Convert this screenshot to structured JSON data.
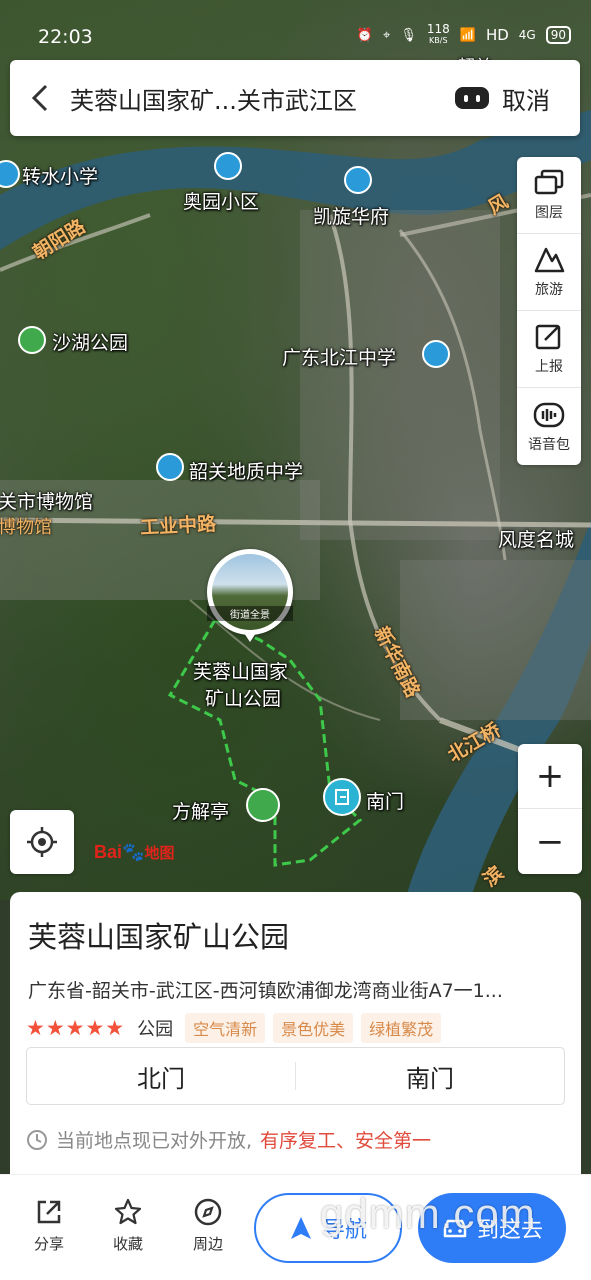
{
  "status_bar": {
    "time": "22:03",
    "speed_value": "118",
    "speed_unit": "KB/S",
    "hd": "HD",
    "network": "4G",
    "battery": "90"
  },
  "search": {
    "title": "芙蓉山国家矿...关市武江区",
    "cancel_label": "取消"
  },
  "tools": [
    {
      "label": "图层",
      "icon": "layers-icon"
    },
    {
      "label": "旅游",
      "icon": "travel-icon"
    },
    {
      "label": "上报",
      "icon": "report-edit-icon"
    },
    {
      "label": "语音包",
      "icon": "voice-pack-icon"
    }
  ],
  "map": {
    "pois": {
      "zhuanshui": "转水小学",
      "aoyuan": "奥园小区",
      "kaixuan": "凯旋华府",
      "shahu": "沙湖公园",
      "beijiang_school": "广东北江中学",
      "dizhi_school": "韶关地质中学",
      "museum": "关市博物馆",
      "museum2": "博物馆",
      "fengdu": "风度名城",
      "park_line1": "芙蓉山国家",
      "park_line2": "矿山公园",
      "fangjie": "方解亭",
      "nanmen": "南门",
      "top_right": "韶关"
    },
    "roads": {
      "chaoyang": "朝阳路",
      "gongyezhong": "工业中路",
      "xinhuanan": "新华南路",
      "beijiangqiao": "北江桥",
      "feng": "风",
      "bin": "滨"
    },
    "streetview_caption": "街道全景",
    "baidu_logo": "Bai地图"
  },
  "zoom": {
    "in": "+",
    "out": "−"
  },
  "place": {
    "name": "芙蓉山国家矿山公园",
    "address": "广东省-韶关市-武江区-西河镇欧浦御龙湾商业街A7一1...",
    "rating_stars": "★★★★★",
    "category": "公园",
    "tags": [
      "空气清新",
      "景色优美",
      "绿植繁茂"
    ],
    "gates": [
      "北门",
      "南门"
    ],
    "notice_text": "当前地点现已对外开放,",
    "notice_highlight": "有序复工、安全第一"
  },
  "bottom_bar": {
    "share": "分享",
    "favorite": "收藏",
    "nearby": "周边",
    "navigate": "导航",
    "route": "到这去"
  },
  "watermark": "gdmm.com",
  "colors": {
    "accent_blue": "#2e7cf6",
    "star_red": "#f3513a",
    "tag_orange": "#d78a4a",
    "notice_red": "#e04b3c",
    "park_boundary": "#3ec94a"
  }
}
